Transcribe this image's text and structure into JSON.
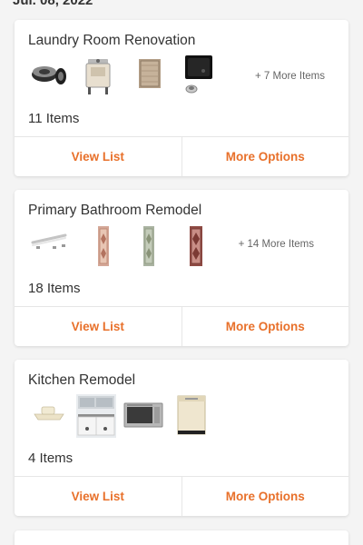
{
  "date_header": "Jul. 08, 2022",
  "lists": [
    {
      "title": "Laundry Room Renovation",
      "count": "11 Items",
      "more_items": "+ 7 More Items",
      "thumbnails": [
        "drain-parts-icon",
        "utility-sink-icon",
        "cabinet-icon",
        "black-sink-icon"
      ],
      "view_label": "View List",
      "options_label": "More Options"
    },
    {
      "title": "Primary Bathroom Remodel",
      "count": "18 Items",
      "more_items": "+ 14 More Items",
      "thumbnails": [
        "towel-bar-icon",
        "runner-rug-icon",
        "runner-rug-icon",
        "runner-rug-icon"
      ],
      "view_label": "View List",
      "options_label": "More Options"
    },
    {
      "title": "Kitchen Remodel",
      "count": "4 Items",
      "more_items": "",
      "thumbnails": [
        "sink-icon",
        "kitchen-icon",
        "microwave-drawer-icon",
        "dishwasher-icon"
      ],
      "view_label": "View List",
      "options_label": "More Options"
    }
  ],
  "colors": {
    "accent": "#e8702a",
    "background": "#f4f4f4",
    "card": "#ffffff",
    "text": "#333333"
  }
}
